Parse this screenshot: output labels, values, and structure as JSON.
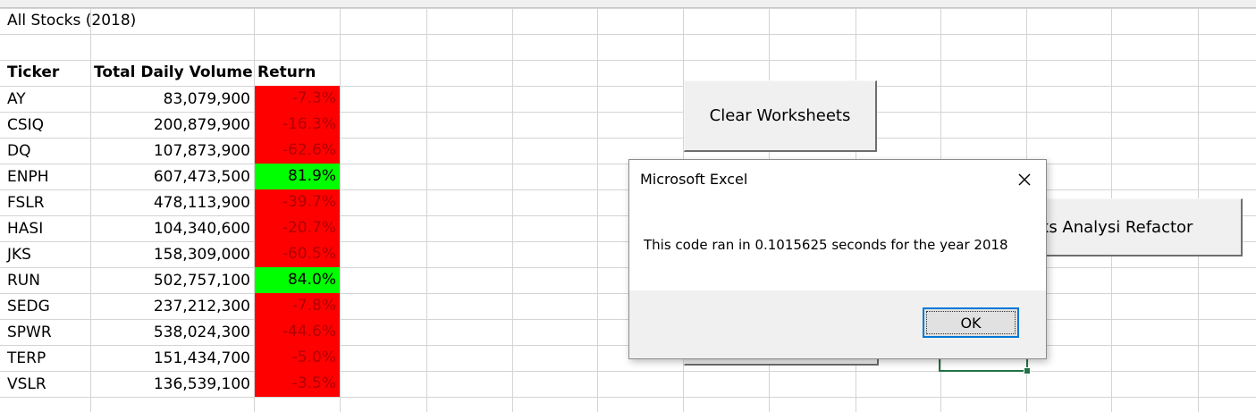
{
  "sheet": {
    "title_cell": "All Stocks (2018)",
    "headers": {
      "ticker": "Ticker",
      "volume": "Total Daily Volume",
      "return": "Return"
    },
    "rows": [
      {
        "ticker": "AY",
        "volume": "83,079,900",
        "return": "-7.3%",
        "status": "negative"
      },
      {
        "ticker": "CSIQ",
        "volume": "200,879,900",
        "return": "-16.3%",
        "status": "negative"
      },
      {
        "ticker": "DQ",
        "volume": "107,873,900",
        "return": "-62.6%",
        "status": "negative"
      },
      {
        "ticker": "ENPH",
        "volume": "607,473,500",
        "return": "81.9%",
        "status": "positive"
      },
      {
        "ticker": "FSLR",
        "volume": "478,113,900",
        "return": "-39.7%",
        "status": "negative"
      },
      {
        "ticker": "HASI",
        "volume": "104,340,600",
        "return": "-20.7%",
        "status": "negative"
      },
      {
        "ticker": "JKS",
        "volume": "158,309,000",
        "return": "-60.5%",
        "status": "negative"
      },
      {
        "ticker": "RUN",
        "volume": "502,757,100",
        "return": "84.0%",
        "status": "positive"
      },
      {
        "ticker": "SEDG",
        "volume": "237,212,300",
        "return": "-7.8%",
        "status": "negative"
      },
      {
        "ticker": "SPWR",
        "volume": "538,024,300",
        "return": "-44.6%",
        "status": "negative"
      },
      {
        "ticker": "TERP",
        "volume": "151,434,700",
        "return": "-5.0%",
        "status": "negative"
      },
      {
        "ticker": "VSLR",
        "volume": "136,539,100",
        "return": "-3.5%",
        "status": "negative"
      }
    ],
    "colors": {
      "negative": "#ff0000",
      "positive": "#00ff00",
      "selection": "#217346"
    }
  },
  "buttons": {
    "clear_worksheets": "Clear Worksheets",
    "refactor_partial": "cks Analysi Refactor"
  },
  "dialog": {
    "title": "Microsoft Excel",
    "message": "This code ran in 0.1015625 seconds for the year 2018",
    "ok_label": "OK",
    "close_icon": "close-icon"
  }
}
